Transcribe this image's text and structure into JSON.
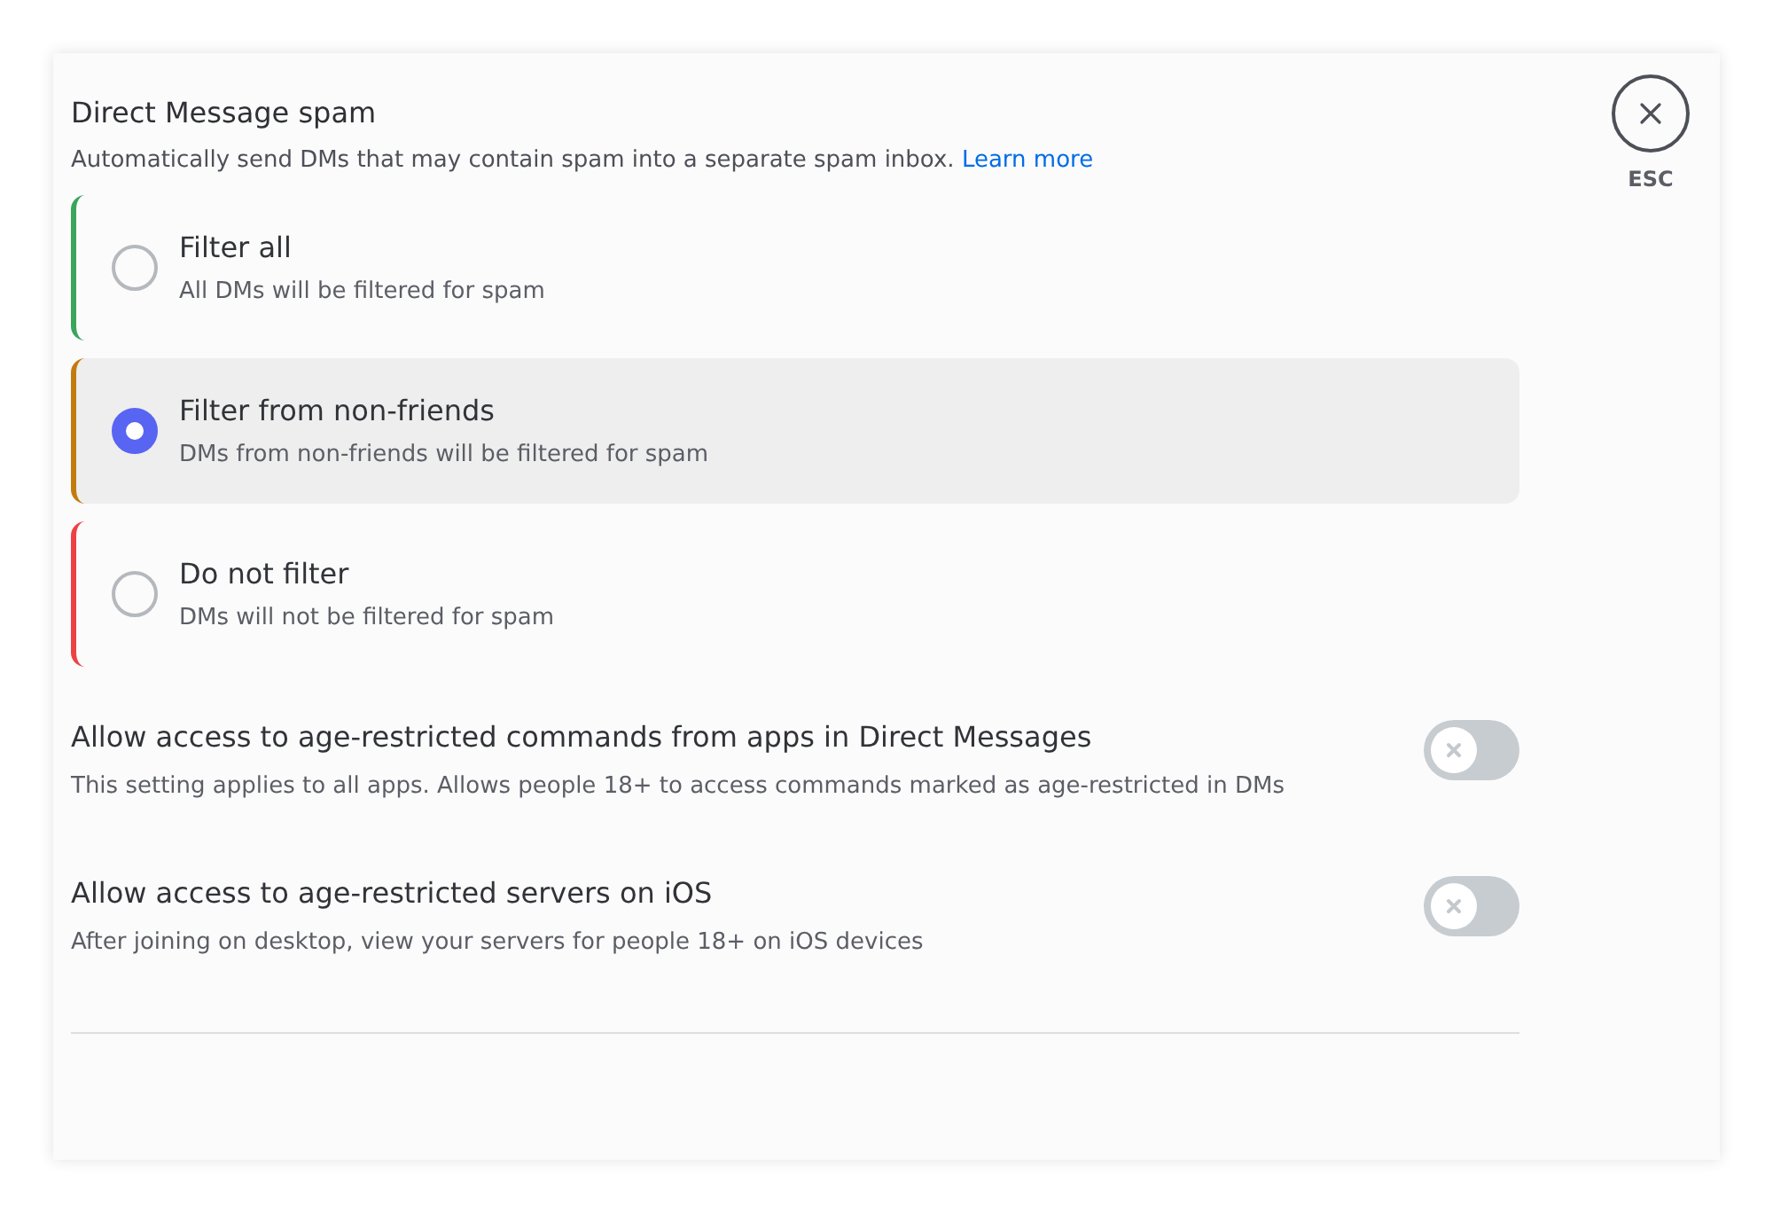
{
  "section": {
    "title": "Direct Message spam",
    "description": "Automatically send DMs that may contain spam into a separate spam inbox.",
    "link": "Learn more"
  },
  "options": [
    {
      "label": "Filter all",
      "description": "All DMs will be filtered for spam",
      "selected": false,
      "color": "#3ba55c"
    },
    {
      "label": "Filter from non-friends",
      "description": "DMs from non-friends will be filtered for spam",
      "selected": true,
      "color": "#c27c0e"
    },
    {
      "label": "Do not filter",
      "description": "DMs will not be filtered for spam",
      "selected": false,
      "color": "#ed4245"
    }
  ],
  "settings": [
    {
      "title": "Allow access to age-restricted commands from apps in Direct Messages",
      "description": "This setting applies to all apps. Allows people 18+ to access commands marked as age-restricted in DMs",
      "on": false
    },
    {
      "title": "Allow access to age-restricted servers on iOS",
      "description": "After joining on desktop, view your servers for people 18+ on iOS devices",
      "on": false
    }
  ],
  "close": {
    "label": "ESC"
  }
}
